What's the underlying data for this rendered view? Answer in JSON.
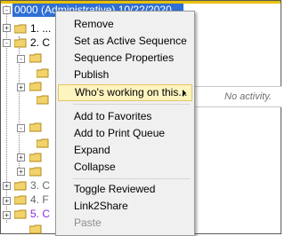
{
  "tree": {
    "selected_node": "0000 (Administrative) 10/22/2020",
    "visible_fragments": [
      "1. ...",
      "2. C",
      "3. C",
      "4. F",
      "5. C"
    ]
  },
  "activity_column": {
    "text": "No activity."
  },
  "context_menu": {
    "items": [
      {
        "label": "Remove",
        "enabled": true
      },
      {
        "label": "Set as Active Sequence",
        "enabled": true
      },
      {
        "label": "Sequence Properties",
        "enabled": true
      },
      {
        "label": "Publish",
        "enabled": true
      },
      {
        "label": "Who's working on this...",
        "enabled": true,
        "has_submenu": true,
        "highlighted": true
      },
      {
        "label": "Add to Favorites",
        "enabled": true
      },
      {
        "label": "Add to Print Queue",
        "enabled": true
      },
      {
        "label": "Expand",
        "enabled": true
      },
      {
        "label": "Collapse",
        "enabled": true
      },
      {
        "label": "Toggle Reviewed",
        "enabled": true
      },
      {
        "label": "Link2Share",
        "enabled": true
      },
      {
        "label": "Paste",
        "enabled": false
      }
    ]
  },
  "colors": {
    "selection": "#2f6fd6",
    "menu_bg": "#f0f0f0",
    "menu_highlight": "#fdf4bf",
    "folder": "#f2d26a",
    "purple_text": "#8a2be2"
  }
}
